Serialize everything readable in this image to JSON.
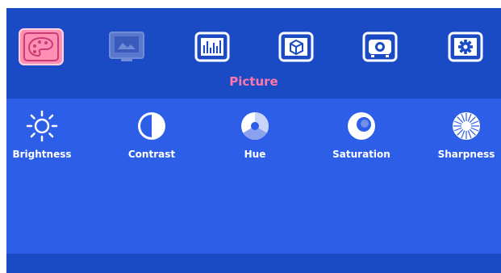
{
  "menu": {
    "tabs": [
      {
        "icon": "palette-icon",
        "state": "selected"
      },
      {
        "icon": "display-screen-icon",
        "state": "disabled"
      },
      {
        "icon": "audio-equalizer-icon",
        "state": "normal"
      },
      {
        "icon": "3d-cube-icon",
        "state": "normal"
      },
      {
        "icon": "projector-icon",
        "state": "normal"
      },
      {
        "icon": "gear-icon",
        "state": "normal"
      }
    ],
    "section_title": "Picture"
  },
  "picture": {
    "items": [
      {
        "label": "Brightness",
        "icon": "sun-icon"
      },
      {
        "label": "Contrast",
        "icon": "contrast-icon"
      },
      {
        "label": "Hue",
        "icon": "hue-wheel-icon"
      },
      {
        "label": "Saturation",
        "icon": "saturation-icon"
      },
      {
        "label": "Sharpness",
        "icon": "sharpness-icon"
      }
    ]
  },
  "colors": {
    "background": "#1e52d0",
    "content_background": "#2c5ee8",
    "accent": "#ff77aa",
    "text": "#ffffff"
  }
}
